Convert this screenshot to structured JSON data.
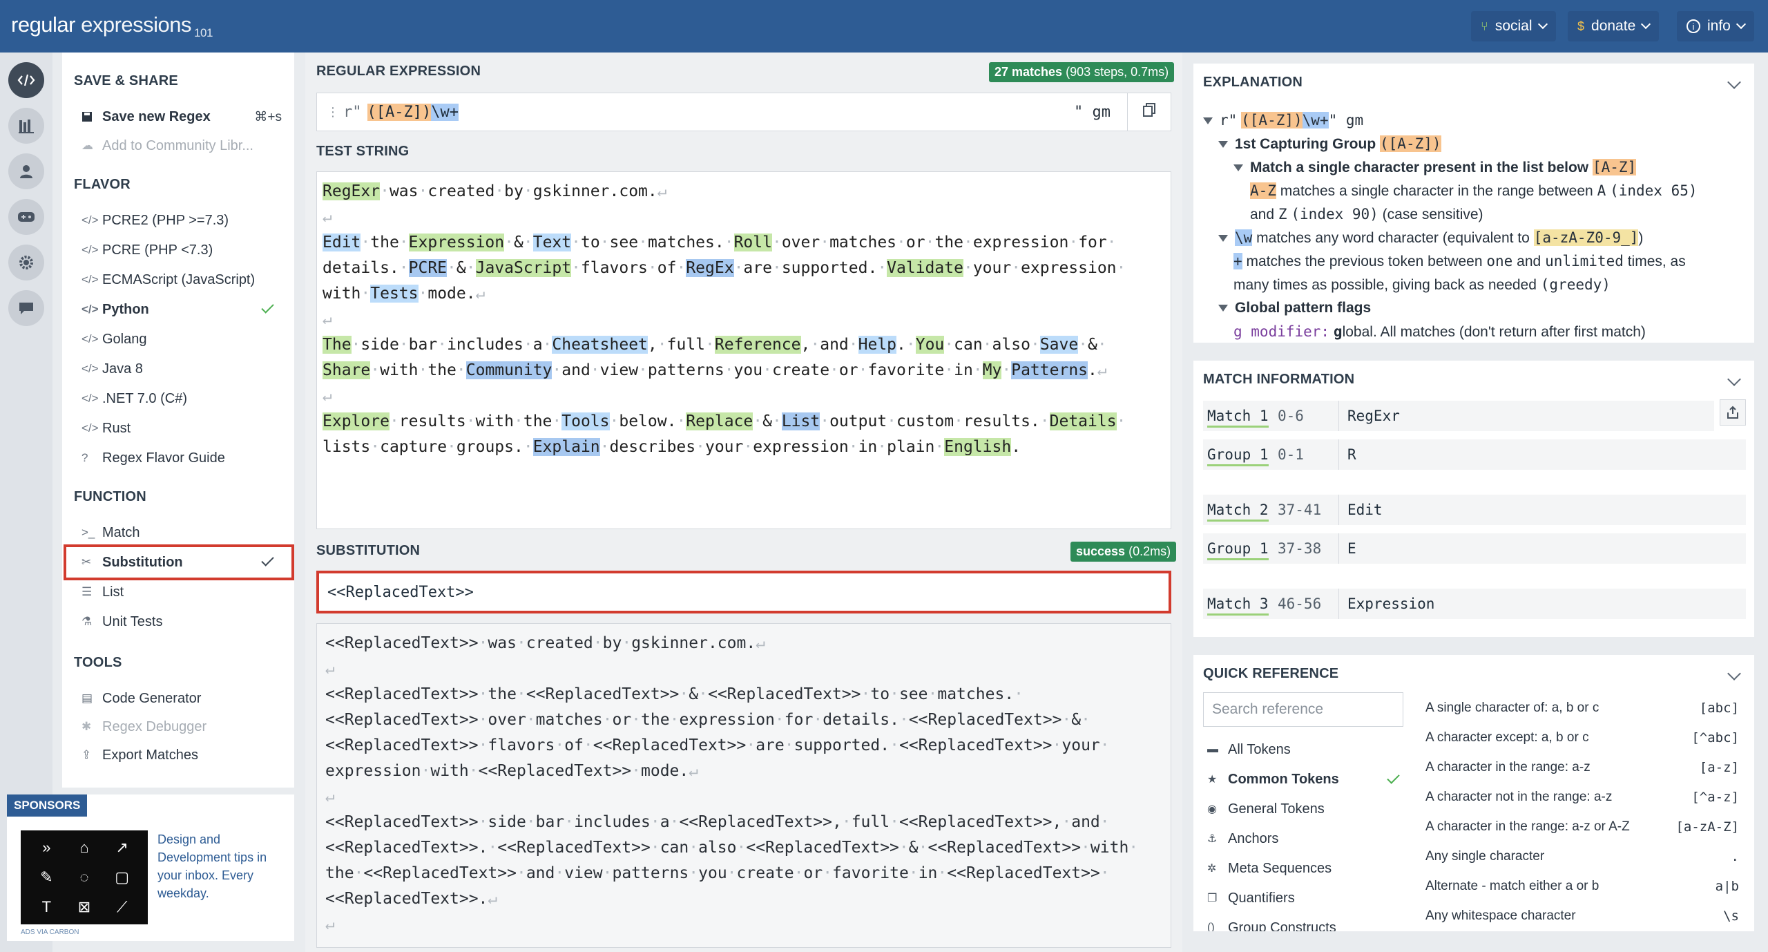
{
  "app": {
    "logo_main": "regular",
    "logo_sub": "expressions",
    "logo_ver": "101"
  },
  "topbar": {
    "social": "social",
    "donate": "donate",
    "info": "info",
    "donate_icon": "$"
  },
  "left": {
    "save_share": "SAVE & SHARE",
    "save_new": "Save new Regex",
    "save_shortcut": "⌘+s",
    "add_community": "Add to Community Libr...",
    "flavor": "FLAVOR",
    "flavors": [
      "PCRE2 (PHP >=7.3)",
      "PCRE (PHP <7.3)",
      "ECMAScript (JavaScript)",
      "Python",
      "Golang",
      "Java 8",
      ".NET 7.0 (C#)",
      "Rust"
    ],
    "flavor_guide": "Regex Flavor Guide",
    "function": "FUNCTION",
    "functions": [
      "Match",
      "Substitution",
      "List",
      "Unit Tests"
    ],
    "tools": "TOOLS",
    "toolitems": [
      "Code Generator",
      "Regex Debugger",
      "Export Matches"
    ]
  },
  "sponsors": {
    "label": "SPONSORS",
    "text": "Design and Development tips in your inbox. Every weekday.",
    "carbon": "ADS VIA CARBON"
  },
  "center": {
    "regex_label": "REGULAR EXPRESSION",
    "match_badge_main": "27 matches",
    "match_badge_sub": "(903 steps, 0.7ms)",
    "regex_prefix": "r\"",
    "regex_group": "([A-Z])",
    "regex_rest": "\\w+",
    "regex_suffix": "\" gm",
    "test_label": "TEST STRING",
    "sub_label": "SUBSTITUTION",
    "sub_badge_main": "success",
    "sub_badge_sub": "(0.2ms)",
    "sub_value": "<<ReplacedText>>"
  },
  "explanation": {
    "title": "EXPLANATION",
    "root_prefix": "r\"",
    "root_group": "([A-Z])",
    "root_rest": "\\w+",
    "root_suffix": "\" gm",
    "g1_title": "1st Capturing Group",
    "g1_token": "([A-Z])",
    "single": "Match a single character present in the list below",
    "single_token": "[A-Z]",
    "range_token": "A-Z",
    "range_text1": "matches a single character in the range between",
    "range_a": "A",
    "range_a_idx": "(index 65)",
    "range_and": "and",
    "range_z": "Z",
    "range_z_idx": "(index 90)",
    "range_case": "(case sensitive)",
    "w_token": "\\w",
    "w_text": "matches any word character (equivalent to",
    "w_equiv": "[a-zA-Z0-9_]",
    "w_close": ")",
    "plus_token": "+",
    "plus_text1": "matches the previous token between",
    "plus_one": "one",
    "plus_and": "and",
    "plus_unl": "unlimited",
    "plus_text2": "times, as",
    "plus_text3": "many times as possible, giving back as needed",
    "plus_greedy": "(greedy)",
    "flags_title": "Global pattern flags",
    "flag_g": "g modifier:",
    "flag_g_b": "g",
    "flag_g_rest": "lobal. All matches (don't return after first match)"
  },
  "matchinfo": {
    "title": "MATCH INFORMATION",
    "rows": [
      {
        "label": "Match 1",
        "range": "0-6",
        "value": "RegExr"
      },
      {
        "label": "Group 1",
        "range": "0-1",
        "value": "R"
      },
      {
        "label": "Match 2",
        "range": "37-41",
        "value": "Edit"
      },
      {
        "label": "Group 1",
        "range": "37-38",
        "value": "E"
      },
      {
        "label": "Match 3",
        "range": "46-56",
        "value": "Expression"
      }
    ]
  },
  "quickref": {
    "title": "QUICK REFERENCE",
    "search_placeholder": "Search reference",
    "cats": [
      "All Tokens",
      "Common Tokens",
      "General Tokens",
      "Anchors",
      "Meta Sequences",
      "Quantifiers",
      "Group Constructs"
    ],
    "rows": [
      {
        "desc": "A single character of: a, b or c",
        "tok": "[abc]"
      },
      {
        "desc": "A character except: a, b or c",
        "tok": "[^abc]"
      },
      {
        "desc": "A character in the range: a-z",
        "tok": "[a-z]"
      },
      {
        "desc": "A character not in the range: a-z",
        "tok": "[^a-z]"
      },
      {
        "desc": "A character in the range: a-z or A-Z",
        "tok": "[a-zA-Z]"
      },
      {
        "desc": "Any single character",
        "tok": "."
      },
      {
        "desc": "Alternate - match either a or b",
        "tok": "a|b"
      },
      {
        "desc": "Any whitespace character",
        "tok": "\\s"
      }
    ]
  },
  "colors": {
    "topbar": "#2e5c94",
    "badge": "#2e8b57",
    "highlight": "#d23b2e"
  }
}
